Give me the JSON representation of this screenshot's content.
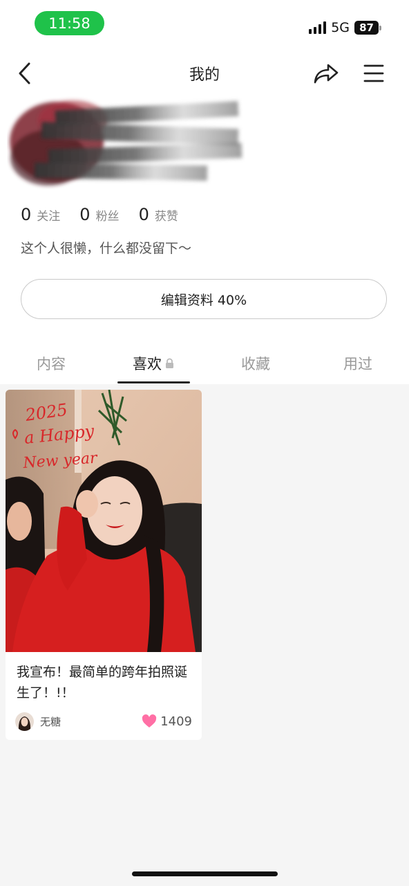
{
  "status_bar": {
    "time": "11:58",
    "network": "5G",
    "battery": "87"
  },
  "header": {
    "title": "我的",
    "back_icon": "chevron-left-icon",
    "share_icon": "share-icon",
    "menu_icon": "hamburger-menu-icon"
  },
  "profile": {
    "stats": [
      {
        "value": "0",
        "label": "关注"
      },
      {
        "value": "0",
        "label": "粉丝"
      },
      {
        "value": "0",
        "label": "获赞"
      }
    ],
    "bio": "这个人很懒，什么都没留下～",
    "edit_button": "编辑资料 40%"
  },
  "tabs": [
    {
      "label": "内容",
      "active": false
    },
    {
      "label": "喜欢",
      "active": true,
      "icon": "lock-icon"
    },
    {
      "label": "收藏",
      "active": false
    },
    {
      "label": "用过",
      "active": false
    }
  ],
  "feed": [
    {
      "title": "我宣布！最简单的跨年拍照诞生了！!！",
      "author": "无糖",
      "likes": "1409",
      "photo_text": [
        "2025",
        "a Happy",
        "New year"
      ],
      "like_icon": "heart-icon"
    }
  ],
  "colors": {
    "accent_green": "#1fc24a",
    "heart_pink": "#ff6fa5",
    "sweater_red": "#d61f1f"
  }
}
